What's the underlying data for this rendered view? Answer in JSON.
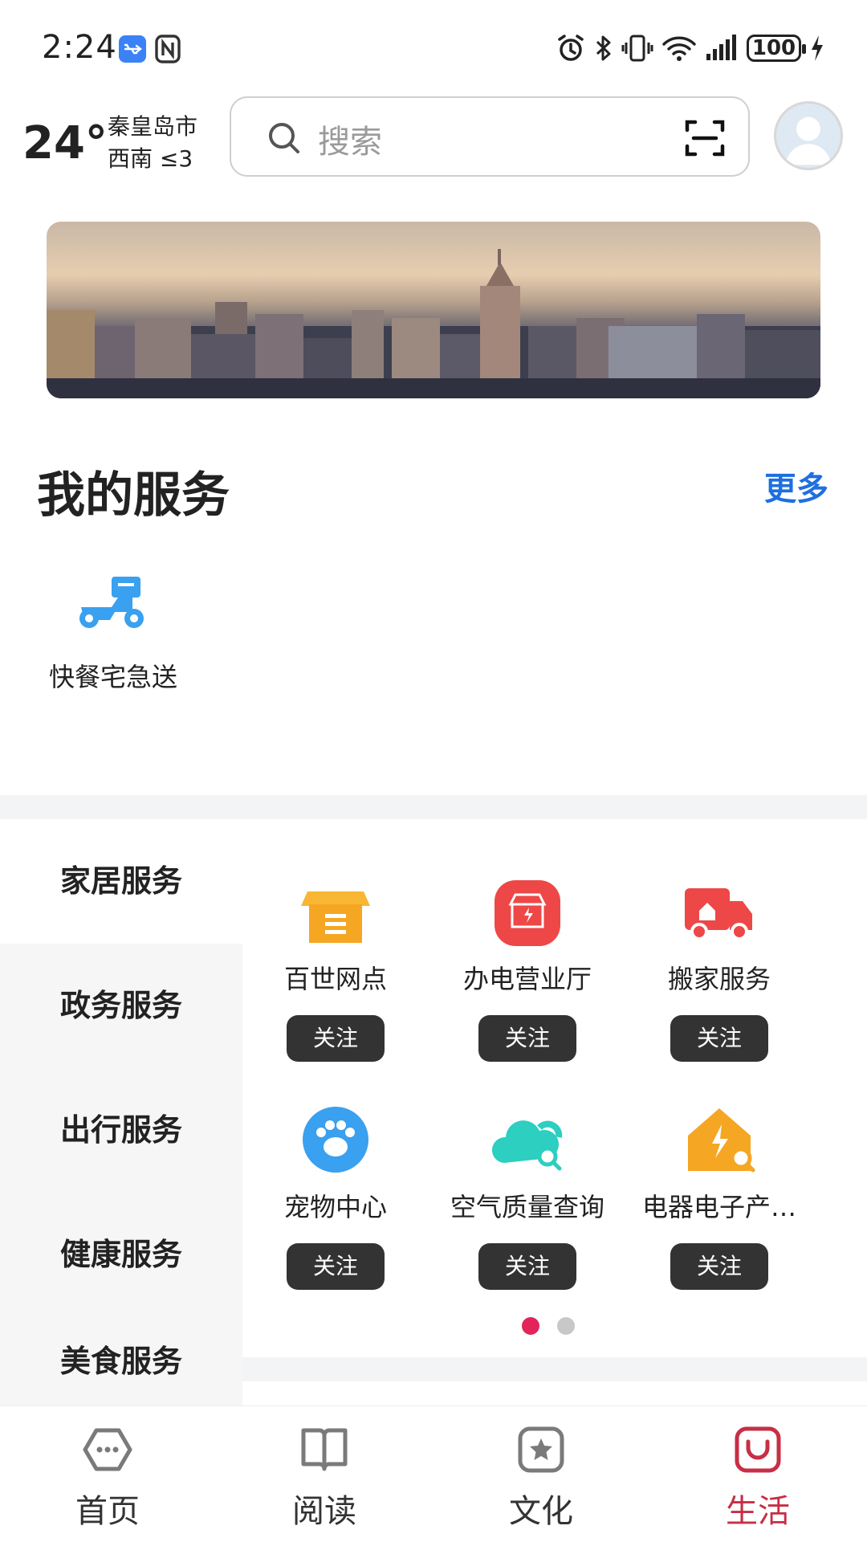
{
  "status_bar": {
    "time": "2:24",
    "battery": "100",
    "icons": [
      "usb-icon",
      "nfc-icon",
      "alarm-icon",
      "bluetooth-icon",
      "vibrate-icon",
      "wifi-icon",
      "signal-icon",
      "charging-icon"
    ]
  },
  "header": {
    "temperature": "24°",
    "city": "秦皇岛市",
    "wind": "西南  ≤3",
    "search_placeholder": "搜索"
  },
  "my_services": {
    "title": "我的服务",
    "more_label": "更多",
    "items": [
      {
        "label": "快餐宅急送",
        "icon": "scooter-icon",
        "color": "#3aa0f0"
      }
    ]
  },
  "categories": {
    "items": [
      {
        "label": "家居服务",
        "active": true
      },
      {
        "label": "政务服务",
        "active": false
      },
      {
        "label": "出行服务",
        "active": false
      },
      {
        "label": "健康服务",
        "active": false
      },
      {
        "label": "美食服务",
        "active": false
      }
    ]
  },
  "service_grid": {
    "follow_label": "关注",
    "items": [
      {
        "label": "百世网点",
        "icon": "package-box-icon",
        "color": "#f5a623"
      },
      {
        "label": "办电营业厅",
        "icon": "power-store-icon",
        "color": "#ee4747"
      },
      {
        "label": "搬家服务",
        "icon": "moving-truck-icon",
        "color": "#ee4747"
      },
      {
        "label": "宠物中心",
        "icon": "paw-icon",
        "color": "#3aa0f0"
      },
      {
        "label": "空气质量查询",
        "icon": "cloud-search-icon",
        "color": "#2ccfc0"
      },
      {
        "label": "电器电子产…",
        "icon": "appliance-house-icon",
        "color": "#f5a623"
      }
    ],
    "page_count": 2,
    "current_page": 1
  },
  "bottom_nav": {
    "items": [
      {
        "label": "首页",
        "icon": "home-hexagon-icon",
        "active": false
      },
      {
        "label": "阅读",
        "icon": "book-icon",
        "active": false
      },
      {
        "label": "文化",
        "icon": "star-square-icon",
        "active": false
      },
      {
        "label": "生活",
        "icon": "life-bag-icon",
        "active": true
      }
    ],
    "active_color": "#c62f45"
  }
}
